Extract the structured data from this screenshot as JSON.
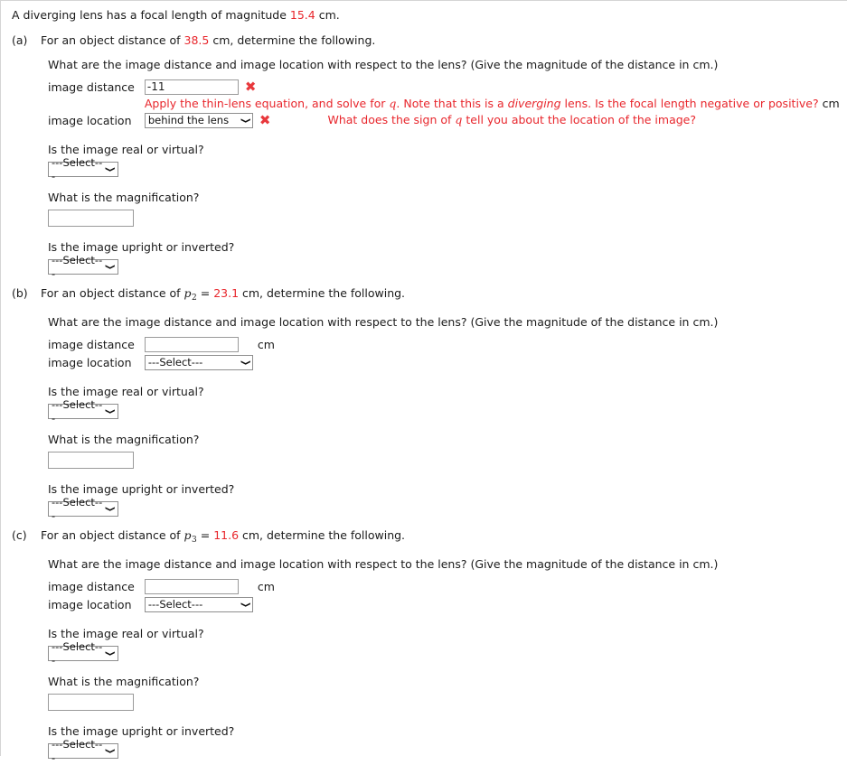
{
  "problem": {
    "intro_pre": "A diverging lens has a focal length of magnitude ",
    "intro_value": "15.4",
    "intro_post": " cm."
  },
  "common": {
    "question_image_dist_loc": "What are the image distance and image location with respect to the lens? (Give the magnitude of the distance in cm.)",
    "label_image_distance": "image distance",
    "label_image_location": "image location",
    "unit_cm": "cm",
    "question_real_virtual": "Is the image real or virtual?",
    "question_magnification": "What is the magnification?",
    "question_upright_inverted": "Is the image upright or inverted?",
    "select_placeholder": "---Select---",
    "caret_glyph": "✖",
    "chevron_glyph": "⌄",
    "accent_red": "#e8262c",
    "input_border": "#9a9a9a"
  },
  "parts": [
    {
      "id": "a",
      "label": "(a)",
      "stem_pre": "For an object distance of ",
      "stem_value": "38.5",
      "stem_post": " cm, determine the following.",
      "has_var": false,
      "var_name": "",
      "var_sub": "",
      "image_distance_value": "-11",
      "image_distance_unit": "",
      "image_distance_incorrect": true,
      "image_location_value": "behind the lens",
      "image_location_incorrect": true,
      "feedback_distance_parts": [
        {
          "text": "Apply the thin-lens equation, and solve for ",
          "style": "plain"
        },
        {
          "text": "q",
          "style": "var"
        },
        {
          "text": ". Note that this is a ",
          "style": "plain"
        },
        {
          "text": "diverging",
          "style": "italic"
        },
        {
          "text": " lens. Is the focal length negative or positive?",
          "style": "plain"
        },
        {
          "text": " cm",
          "style": "black"
        }
      ],
      "feedback_location_parts": [
        {
          "text": "What does the sign of ",
          "style": "plain"
        },
        {
          "text": "q",
          "style": "var"
        },
        {
          "text": " tell you about the location of the image?",
          "style": "plain"
        }
      ],
      "real_virtual_value": "---Select---",
      "magnification_value": "",
      "upright_inverted_value": "---Select---"
    },
    {
      "id": "b",
      "label": "(b)",
      "stem_pre": "For an object distance of ",
      "stem_value": "23.1",
      "stem_post": " cm, determine the following.",
      "has_var": true,
      "var_name": "p",
      "var_sub": "2",
      "image_distance_value": "",
      "image_distance_unit": "cm",
      "image_distance_incorrect": false,
      "image_location_value": "---Select---",
      "image_location_incorrect": false,
      "feedback_distance_parts": [],
      "feedback_location_parts": [],
      "real_virtual_value": "---Select---",
      "magnification_value": "",
      "upright_inverted_value": "---Select---"
    },
    {
      "id": "c",
      "label": "(c)",
      "stem_pre": "For an object distance of ",
      "stem_value": "11.6",
      "stem_post": " cm, determine the following.",
      "has_var": true,
      "var_name": "p",
      "var_sub": "3",
      "image_distance_value": "",
      "image_distance_unit": "cm",
      "image_distance_incorrect": false,
      "image_location_value": "---Select---",
      "image_location_incorrect": false,
      "feedback_distance_parts": [],
      "feedback_location_parts": [],
      "real_virtual_value": "---Select---",
      "magnification_value": "",
      "upright_inverted_value": "---Select---"
    }
  ]
}
